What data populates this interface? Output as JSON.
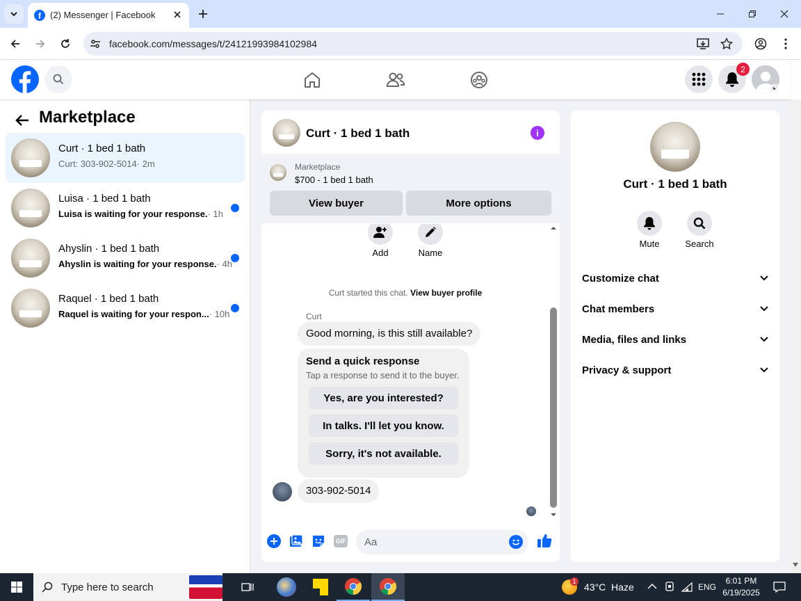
{
  "browser": {
    "tab_title": "(2) Messenger | Facebook",
    "url": "facebook.com/messages/t/24121993984102984"
  },
  "header": {
    "notification_count": "2"
  },
  "sidebar": {
    "title": "Marketplace",
    "conversations": [
      {
        "name": "Curt · 1 bed 1 bath",
        "preview": "Curt: 303-902-5014",
        "time": "· 2m",
        "unread": false
      },
      {
        "name": "Luisa · 1 bed 1 bath",
        "preview": "Luisa is waiting for your response.",
        "time": "· 1h",
        "unread": true
      },
      {
        "name": "Ahyslin · 1 bed 1 bath",
        "preview": "Ahyslin is waiting for your response.",
        "time": "· 4h",
        "unread": true
      },
      {
        "name": "Raquel · 1 bed 1 bath",
        "preview": "Raquel is waiting for your respon...",
        "time": "· 10h",
        "unread": true
      }
    ]
  },
  "chat": {
    "title": "Curt · 1 bed 1 bath",
    "listing_source": "Marketplace",
    "listing_title": "$700 - 1 bed 1 bath",
    "view_buyer_label": "View buyer",
    "more_options_label": "More options",
    "add_label": "Add",
    "name_label": "Name",
    "started_text": "Curt started this chat.",
    "view_buyer_profile": "View buyer profile",
    "sender_name": "Curt",
    "message1": "Good morning, is this still available?",
    "quick_title": "Send a quick response",
    "quick_subtitle": "Tap a response to send it to the buyer.",
    "quick_responses": [
      "Yes, are you interested?",
      "In talks. I'll let you know.",
      "Sorry, it's not available."
    ],
    "message2": "303-902-5014",
    "composer_placeholder": "Aa"
  },
  "info": {
    "name": "Curt · 1 bed 1 bath",
    "mute_label": "Mute",
    "search_label": "Search",
    "sections": [
      "Customize chat",
      "Chat members",
      "Media, files and links",
      "Privacy & support"
    ]
  },
  "taskbar": {
    "search_placeholder": "Type here to search",
    "weather_badge": "1",
    "weather": "43°C  Haze",
    "language": "ENG",
    "time": "6:01 PM",
    "date": "6/19/2025"
  },
  "colors": {
    "facebook_blue": "#0866ff",
    "messenger_purple": "#a033ff",
    "notification_red": "#e41e3f"
  }
}
